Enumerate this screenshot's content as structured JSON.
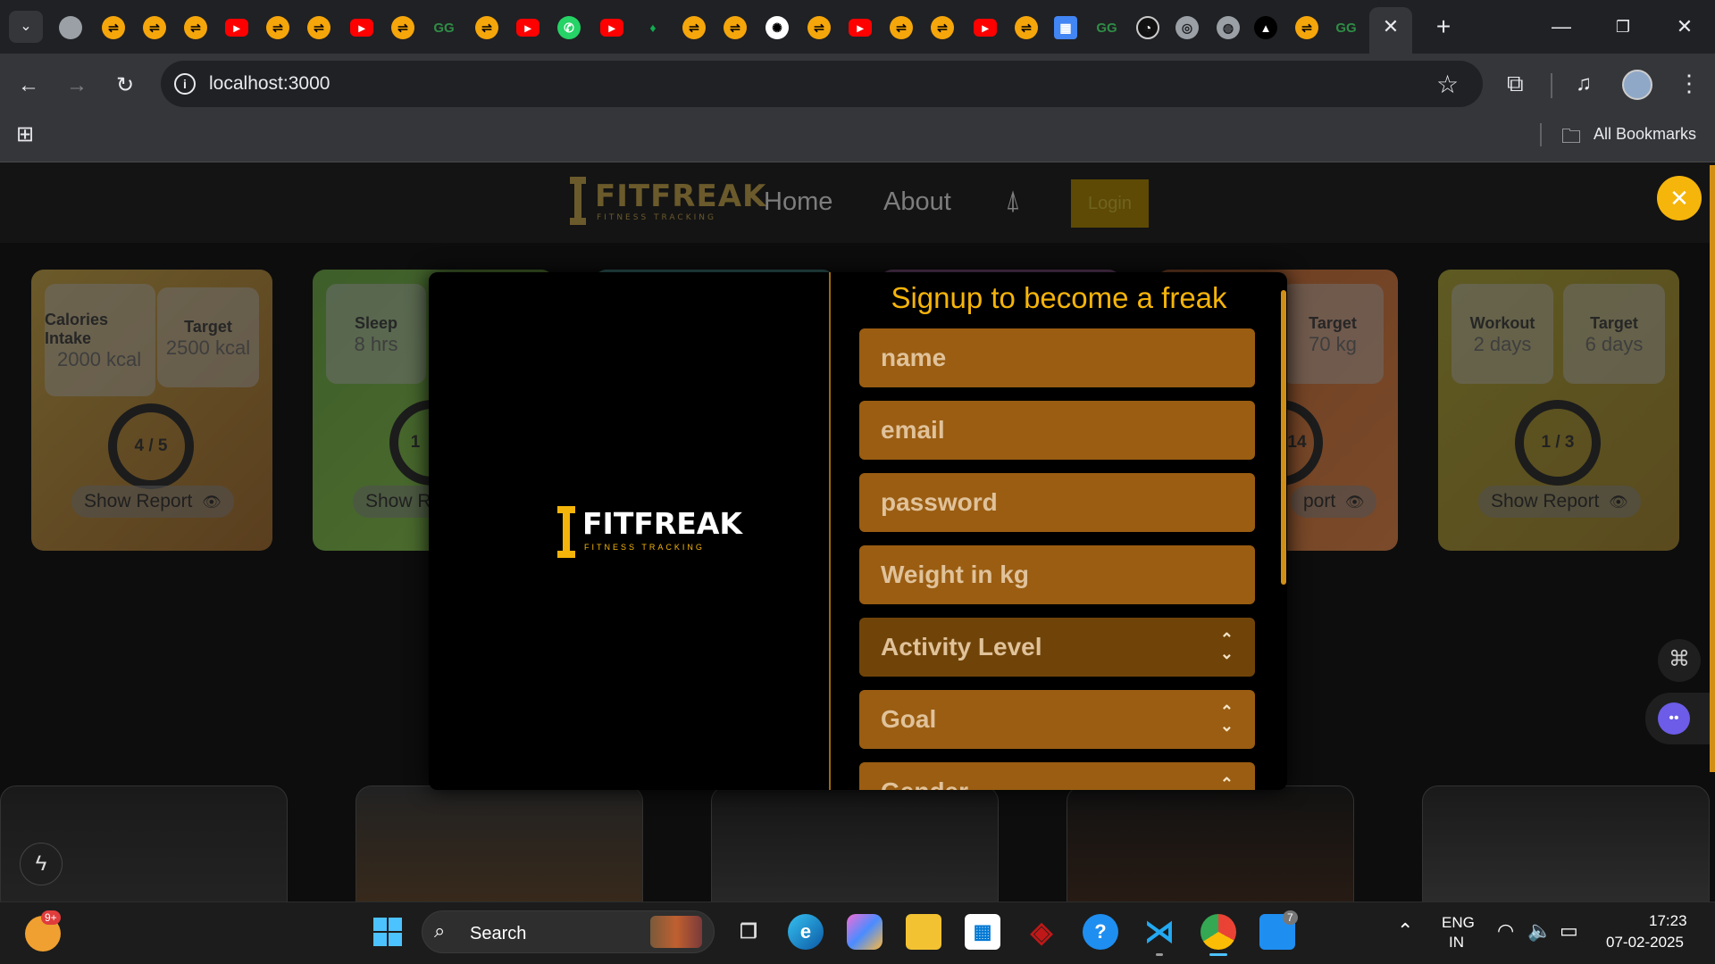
{
  "browser": {
    "url": "localhost:3000",
    "bookmarks_label": "All Bookmarks",
    "tabs": [
      "youtube",
      "strava",
      "chatgpt",
      "whatsapp",
      "github",
      "chrome",
      "vercel",
      "geeksforgeeks"
    ]
  },
  "site": {
    "logo_main": "FITFREAK",
    "logo_sub": "FITNESS TRACKING",
    "nav": {
      "home": "Home",
      "about": "About",
      "login": "Login"
    }
  },
  "cards": [
    {
      "label": "Calories Intake",
      "value": "2000 kcal",
      "target_label": "Target",
      "target_value": "2500 kcal",
      "progress": "4 / 5",
      "report": "Show Report"
    },
    {
      "label": "Sleep",
      "value": "8 hrs",
      "progress": "1",
      "report": "Show R"
    },
    {
      "target_label": "Target",
      "target_value": "70 kg",
      "progress": "14",
      "report": "port"
    },
    {
      "label": "Workout",
      "value": "2 days",
      "target_label": "Target",
      "target_value": "6 days",
      "progress": "1 / 3",
      "report": "Show Report"
    }
  ],
  "modal": {
    "title": "Signup to become a freak",
    "fields": {
      "name": "name",
      "email": "email",
      "password": "password",
      "weight": "Weight in kg",
      "activity": "Activity Level",
      "goal": "Goal",
      "gender": "Gender"
    }
  },
  "taskbar": {
    "search_label": "Search",
    "lang_1": "ENG",
    "lang_2": "IN",
    "time": "17:23",
    "date": "07-02-2025",
    "weather_badge": "9+",
    "notif_badge": "7"
  },
  "colors": {
    "accent": "#f5b40a",
    "field_bg": "#9a5d12",
    "select_bg": "#704409"
  }
}
